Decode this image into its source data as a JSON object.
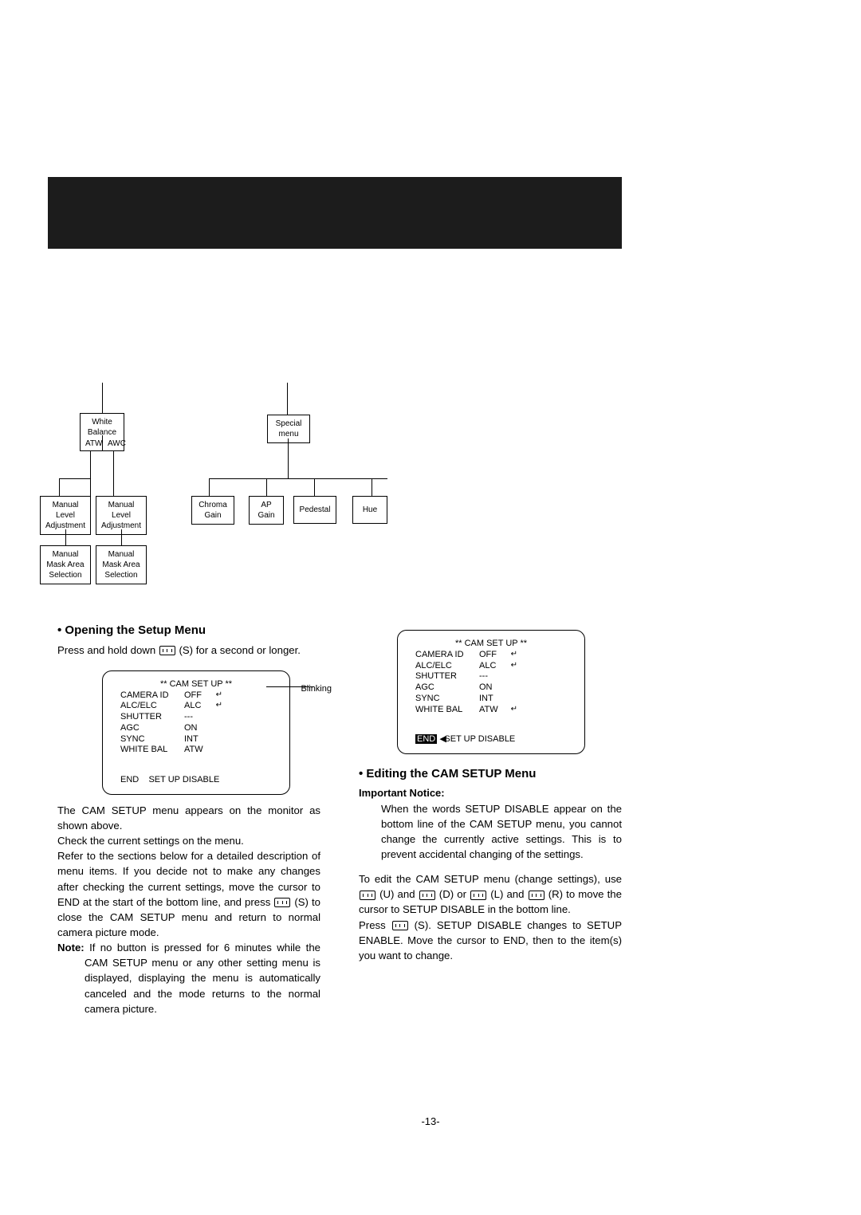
{
  "diagram": {
    "white_balance": "White\nBalance",
    "atw": "ATW",
    "awc": "AWC",
    "manual_level_adj": "Manual\nLevel\nAdjustment",
    "manual_mask_area": "Manual\nMask Area\nSelection",
    "special_menu": "Special\nmenu",
    "chroma_gain": "Chroma\nGain",
    "ap_gain": "AP\nGain",
    "pedestal": "Pedestal",
    "hue": "Hue"
  },
  "blinking_label": "Blinking",
  "osd": {
    "title": "** CAM SET UP **",
    "rows": [
      {
        "label": "CAMERA ID",
        "value": "OFF",
        "arrow": true
      },
      {
        "label": "ALC/ELC",
        "value": "ALC",
        "arrow": true
      },
      {
        "label": "SHUTTER",
        "value": "---",
        "arrow": false
      },
      {
        "label": "AGC",
        "value": "ON",
        "arrow": false
      },
      {
        "label": "SYNC",
        "value": "INT",
        "arrow": false
      },
      {
        "label": "WHITE BAL",
        "value": "ATW",
        "arrow": false
      }
    ],
    "end": "END",
    "setup_disable": "SET UP DISABLE",
    "white_bal_arrow_right": true
  },
  "left": {
    "heading": "• Opening the Setup Menu",
    "p1a": "Press and hold down ",
    "p1b": " (S) for a second or longer.",
    "p2": "The CAM SETUP menu appears on the monitor as shown above.",
    "p3": "Check the current settings on the menu.",
    "p4a": "Refer to the sections below for a detailed description of menu items. If you decide not to make any changes after checking the current settings, move the cursor to END at the start of the bottom line, and press ",
    "p4b": " (S) to close the CAM SETUP menu and return to normal camera picture mode.",
    "note_label": "Note:",
    "note": " If no button is pressed for 6 minutes while the CAM SETUP menu or any other setting menu is displayed, displaying the menu is automatically canceled and the mode returns to the normal camera picture."
  },
  "right": {
    "heading": "• Editing the CAM SETUP Menu",
    "important_label": "Important Notice:",
    "important": "When the words SETUP DISABLE appear on the bottom line of the CAM SETUP menu, you cannot change the currently active settings. This is to prevent accidental changing of the settings.",
    "p1a": "To edit the CAM SETUP menu (change settings), use ",
    "p1b": " (U) and ",
    "p1c": " (D) or ",
    "p1d": " (L) and ",
    "p1e": " (R) to move the cursor to SETUP DISABLE in the bottom line.",
    "p2a": "Press ",
    "p2b": " (S). SETUP DISABLE changes to SETUP ENABLE.  Move the cursor to END, then to the item(s) you want to change."
  },
  "page_number": "-13-"
}
